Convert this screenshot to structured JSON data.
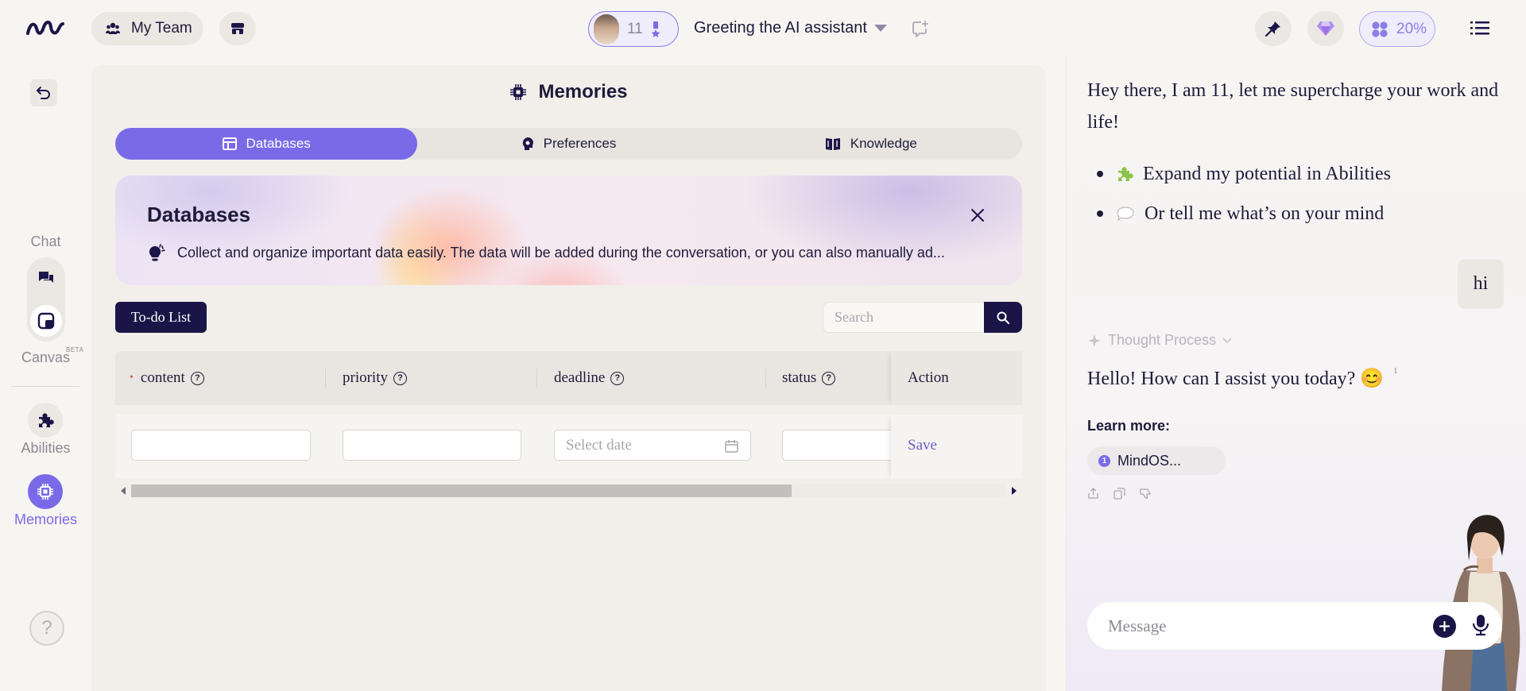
{
  "topbar": {
    "team_label": "My Team",
    "agent_number": "11",
    "conversation_title": "Greeting the AI assistant",
    "usage_percent": "20%"
  },
  "nav": {
    "chat_label": "Chat",
    "canvas_label": "Canvas",
    "beta_label": "BETA",
    "abilities_label": "Abilities",
    "memories_label": "Memories",
    "help_label": "?"
  },
  "memories": {
    "title": "Memories",
    "tabs": [
      {
        "label": "Databases",
        "icon": "table-icon",
        "active": true
      },
      {
        "label": "Preferences",
        "icon": "head-gear-icon",
        "active": false
      },
      {
        "label": "Knowledge",
        "icon": "book-icon",
        "active": false
      }
    ],
    "banner": {
      "title": "Databases",
      "text": "Collect and organize important data easily. The data will be added during the conversation, or you can also manually ad..."
    },
    "database_button": "To-do List",
    "search_placeholder": "Search",
    "table": {
      "columns": [
        {
          "label": "content",
          "required": true
        },
        {
          "label": "priority",
          "required": false
        },
        {
          "label": "deadline",
          "required": false
        },
        {
          "label": "status",
          "required": false
        }
      ],
      "action_header": "Action",
      "date_placeholder": "Select date",
      "save_label": "Save"
    }
  },
  "chat": {
    "greeting": "Hey there, I am 11, let me supercharge your work and life!",
    "suggestions": [
      {
        "icon": "puzzle-icon",
        "text": "Expand my potential in Abilities"
      },
      {
        "icon": "speech-bubble-icon",
        "text": "Or tell me what’s on your mind"
      }
    ],
    "user_message": "hi",
    "thought_label": "Thought Process",
    "answer": "Hello! How can I assist you today? 😊",
    "answer_ref": "1",
    "learn_more_label": "Learn more:",
    "source": {
      "num": "1",
      "label": "MindOS..."
    },
    "composer_placeholder": "Message"
  },
  "colors": {
    "accent": "#7b6ae8",
    "dark": "#1b1547",
    "background": "#f7f5f2"
  }
}
